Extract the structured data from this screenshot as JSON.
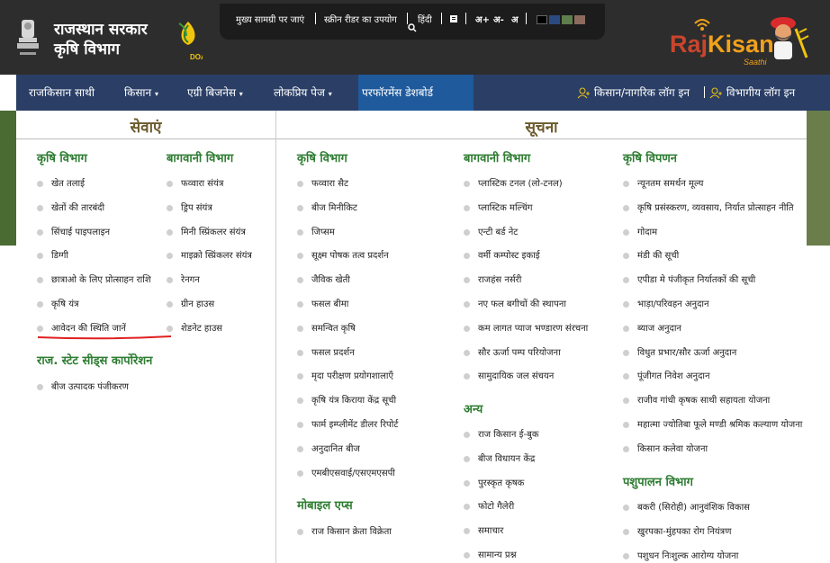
{
  "header": {
    "title_line1": "राजस्थान सरकार",
    "title_line2": "कृषि विभाग",
    "doa_label": "DOA",
    "utility": {
      "main_content": "मुख्य सामग्री पर जाएं",
      "screen_reader": "स्क्रीन रीडर का उपयोग",
      "language": "हिंदी",
      "font_plus": "अ+",
      "font_minus": "अ-",
      "font_normal": "अ",
      "swatches": [
        "#000000",
        "#2b4a80",
        "#5f7e4e",
        "#8c6b5e"
      ]
    },
    "brand": {
      "name_part1": "Raj",
      "name_part2": "Kisan",
      "tagline": "Saathi"
    }
  },
  "nav": {
    "items": [
      {
        "label": "राजकिसान साथी",
        "has_dropdown": false
      },
      {
        "label": "किसान",
        "has_dropdown": true
      },
      {
        "label": "एग्री बिजनेस",
        "has_dropdown": true
      },
      {
        "label": "लोकप्रिय पेज",
        "has_dropdown": true
      },
      {
        "label": "परफॉरमेंस डेशबोर्ड",
        "has_dropdown": false
      }
    ],
    "login_farmer": "किसान/नागरिक लॉग इन",
    "login_dept": "विभागीय लॉग इन"
  },
  "services": {
    "title": "सेवाएं",
    "krishi": {
      "heading": "कृषि विभाग",
      "items": [
        "खेत तलाई",
        "खेतों की तारबंदी",
        "सिंचाई पाइपलाइन",
        "डिग्गी",
        "छात्राओ के लिए प्रोत्साहन राशि",
        "कृषि यंत्र",
        "आवेदन की स्थिति जानें"
      ]
    },
    "bagwani": {
      "heading": "बागवानी विभाग",
      "items": [
        "फव्वारा संयंत्र",
        "ड्रिप संयंत्र",
        "मिनी स्प्रिंकलर संयंत्र",
        "माइक्रो स्प्रिंकलर संयंत्र",
        "रेनगन",
        "ग्रीन हाउस",
        "शेडनेट हाउस"
      ]
    },
    "seeds": {
      "heading": "राज. स्टेट सीड्स कार्पोरेशन",
      "items": [
        "बीज उत्पादक पंजीकरण"
      ]
    }
  },
  "info": {
    "title": "सूचना",
    "krishi": {
      "heading": "कृषि विभाग",
      "items": [
        "फव्वारा सैट",
        "बीज मिनीकिट",
        "जिप्सम",
        "सूक्ष्म पोषक तत्व प्रदर्शन",
        "जैविक खेती",
        "फसल बीमा",
        "समन्वित कृषि",
        "फसल प्रदर्शन",
        "मृदा परीक्षण प्रयोगशालाएँ",
        "कृषि यंत्र किराया केंद्र सूची",
        "फार्म इम्प्लीमेंट डीलर रिपोर्ट",
        "अनुदानित बीज",
        "एमबीएसवाई/एसएमएसपी"
      ]
    },
    "mobile": {
      "heading": "मोबाइल एप्स",
      "items": [
        "राज किसान क्रेता विक्रेता"
      ]
    },
    "bagwani": {
      "heading": "बागवानी विभाग",
      "items": [
        "प्लास्टिक टनल (लो-टनल)",
        "प्लास्टिक मल्चिंग",
        "एन्टी बर्ड नेट",
        "वर्मी कम्पोस्ट इकाई",
        "राजहंस नर्सरी",
        "नए फल बगीचों की स्थापना",
        "कम लागत प्याज भण्डारण संरचना",
        "सौर ऊर्जा पम्प परियोजना",
        "सामुदायिक जल संचयन"
      ]
    },
    "anya": {
      "heading": "अन्य",
      "items": [
        "राज किसान ई-बुक",
        "बीज विधायन केंद्र",
        "पुरस्कृत कृषक",
        "फोटो गैलेरी",
        "समाचार",
        "सामान्य प्रश्न"
      ]
    },
    "vipanan": {
      "heading": "कृषि विपणन",
      "items": [
        "न्यूनतम समर्थन मूल्य",
        "कृषि प्रसंस्करण, व्यवसाय, निर्यात प्रोत्साहन नीति",
        "गोदाम",
        "मंडी की सूची",
        "एपीडा मे पंजीकृत निर्यातकों की सूची",
        "भाड़ा/परिवहन अनुदान",
        "ब्याज अनुदान",
        "विधुत प्रभार/सौर ऊर्जा अनुदान",
        "पूंजीगत निवेश अनुदान",
        "राजीव गांधी कृषक साथी सहायता योजना",
        "महात्मा ज्योतिबा फूले मण्डी श्रमिक कल्याण योजना",
        "किसान कलेवा योजना"
      ]
    },
    "pashupalan": {
      "heading": "पशुपालन विभाग",
      "items": [
        "बकरी (सिरोही) आनुवंशिक विकास",
        "खुरपका-मुंहपका रोग नियंत्रण",
        "पशुधन निःशुल्क आरोग्य योजना"
      ]
    }
  }
}
